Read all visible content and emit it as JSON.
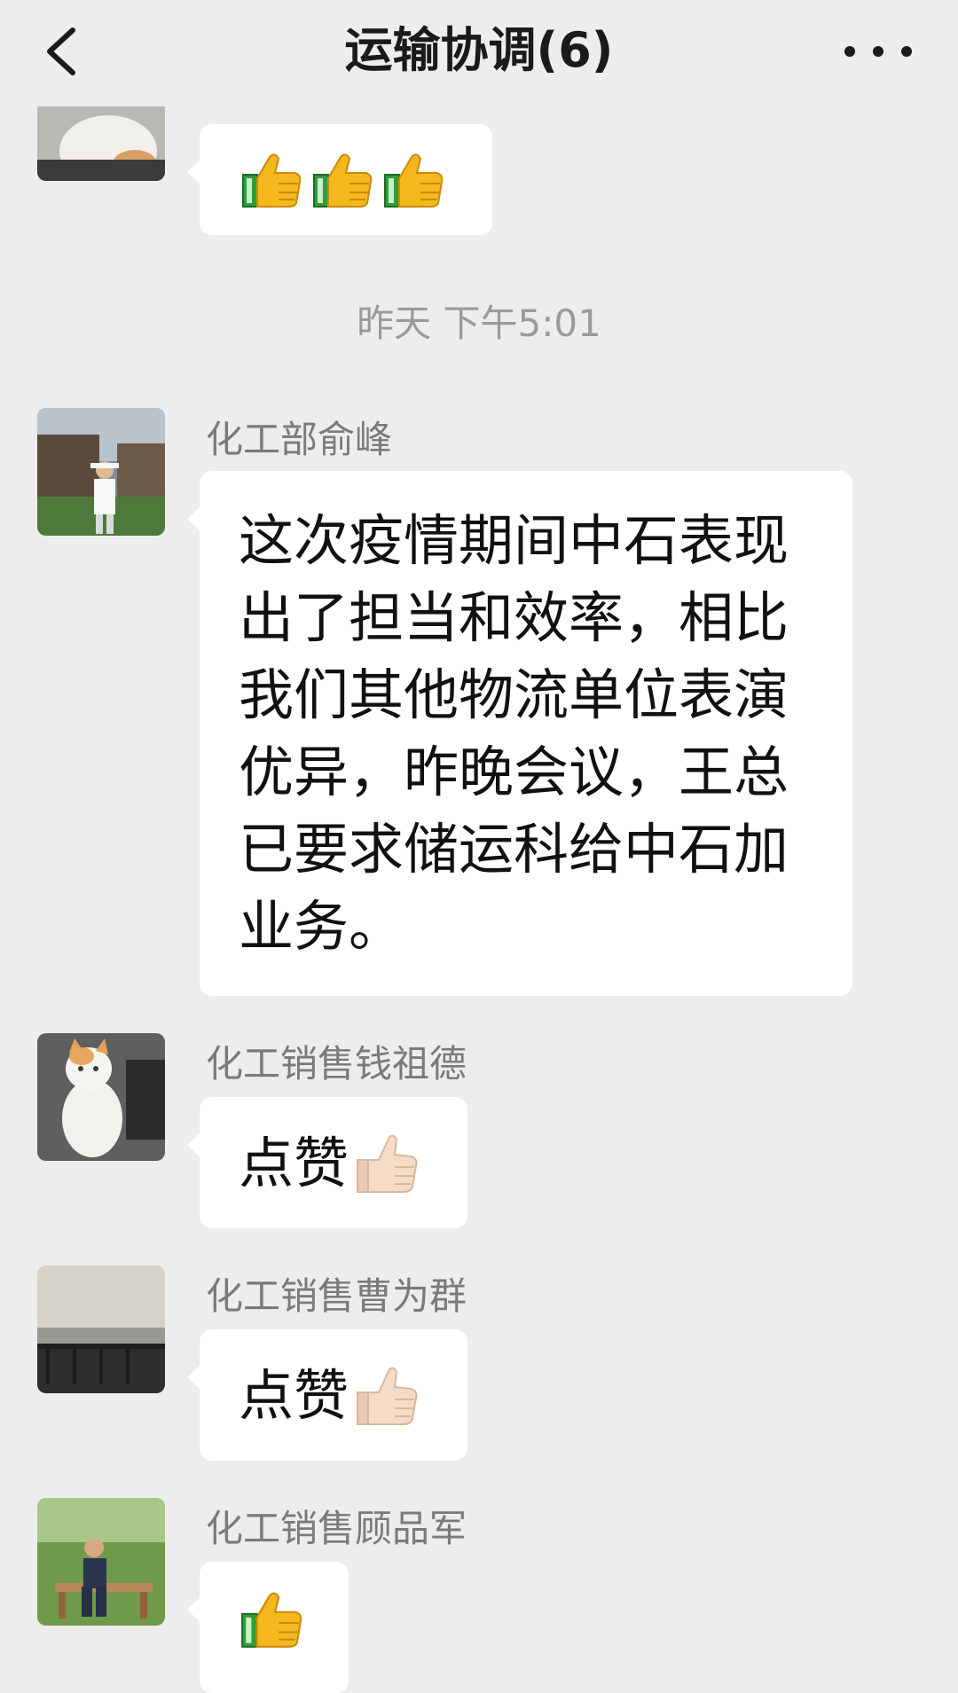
{
  "header": {
    "title": "运输协调(6)",
    "back_icon": "chevron-left-icon",
    "more_icon": "more-dots-icon"
  },
  "messages": [
    {
      "sender": "",
      "content": "👍👍👍",
      "emoji": "thumbs-up-icon"
    },
    {
      "timestamp": "昨天 下午5:01"
    },
    {
      "sender": "化工部俞峰",
      "content": "这次疫情期间中石表现出了担当和效率，相比我们其他物流单位表演优异，昨晚会议，王总已要求储运科给中石加业务。"
    },
    {
      "sender": "化工销售钱祖德",
      "content": "点赞",
      "emoji": "thumbs-up-light-icon"
    },
    {
      "sender": "化工销售曹为群",
      "content": "点赞",
      "emoji": "thumbs-up-light-icon"
    },
    {
      "sender": "化工销售顾品军",
      "content": "👍",
      "emoji": "thumbs-up-icon"
    }
  ],
  "colors": {
    "background": "#ededed",
    "bubble": "#ffffff",
    "name": "#7a7a7a",
    "timestamp": "#9a9a9a",
    "thumb_yellow": "#f5b81f",
    "thumb_green": "#2e9e3a",
    "thumb_skin": "#f4dcc8"
  }
}
